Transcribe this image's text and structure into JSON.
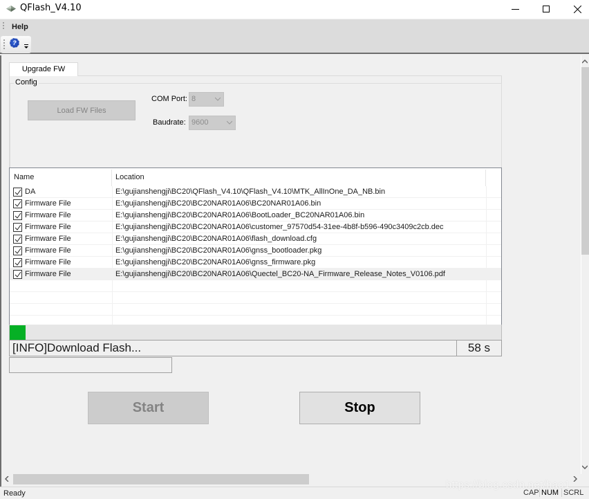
{
  "window": {
    "title": "QFlash_V4.10",
    "controls": {
      "minimize": "minimize",
      "maximize": "maximize",
      "close": "close"
    }
  },
  "menubar": {
    "items": [
      {
        "label": "Help"
      }
    ]
  },
  "toolbar": {
    "items": [
      {
        "icon": "help-icon",
        "glyph": "?"
      }
    ]
  },
  "tabs": [
    {
      "label": "Upgrade FW",
      "active": true
    }
  ],
  "config": {
    "group_label": "Config",
    "load_button": "Load FW Files",
    "com_port": {
      "label": "COM Port:",
      "value": "8"
    },
    "baudrate": {
      "label": "Baudrate:",
      "value": "9600"
    }
  },
  "file_list": {
    "columns": [
      "Name",
      "Location"
    ],
    "rows": [
      {
        "checked": true,
        "name": "DA",
        "location": "E:\\gujianshengji\\BC20\\QFlash_V4.10\\QFlash_V4.10\\MTK_AllInOne_DA_NB.bin"
      },
      {
        "checked": true,
        "name": "Firmware File",
        "location": "E:\\gujianshengji\\BC20\\BC20NAR01A06\\BC20NAR01A06.bin"
      },
      {
        "checked": true,
        "name": "Firmware File",
        "location": "E:\\gujianshengji\\BC20\\BC20NAR01A06\\BootLoader_BC20NAR01A06.bin"
      },
      {
        "checked": true,
        "name": "Firmware File",
        "location": "E:\\gujianshengji\\BC20\\BC20NAR01A06\\customer_97570d54-31ee-4b8f-b596-490c3409c2cb.dec"
      },
      {
        "checked": true,
        "name": "Firmware File",
        "location": "E:\\gujianshengji\\BC20\\BC20NAR01A06\\flash_download.cfg"
      },
      {
        "checked": true,
        "name": "Firmware File",
        "location": "E:\\gujianshengji\\BC20\\BC20NAR01A06\\gnss_bootloader.pkg"
      },
      {
        "checked": true,
        "name": "Firmware File",
        "location": "E:\\gujianshengji\\BC20\\BC20NAR01A06\\gnss_firmware.pkg"
      },
      {
        "checked": true,
        "name": "Firmware File",
        "location": "E:\\gujianshengji\\BC20\\BC20NAR01A06\\Quectel_BC20-NA_Firmware_Release_Notes_V0106.pdf",
        "selected": true
      }
    ]
  },
  "progress": {
    "percent": 3.3,
    "color": "#06b025"
  },
  "status": {
    "message": "[INFO]Download Flash...",
    "elapsed": "58 s",
    "sub_message": ""
  },
  "actions": {
    "start_label": "Start",
    "stop_label": "Stop",
    "start_enabled": false,
    "stop_enabled": true
  },
  "scrollbars": {
    "vertical_position": 0,
    "horizontal_position": 0
  },
  "statusbar": {
    "text": "Ready",
    "indicators": [
      {
        "label": "CAP",
        "active": false
      },
      {
        "label": "NUM",
        "active": true
      },
      {
        "label": "SCRL",
        "active": false
      }
    ]
  },
  "watermark": "https://blog.csdn.net/hao1"
}
